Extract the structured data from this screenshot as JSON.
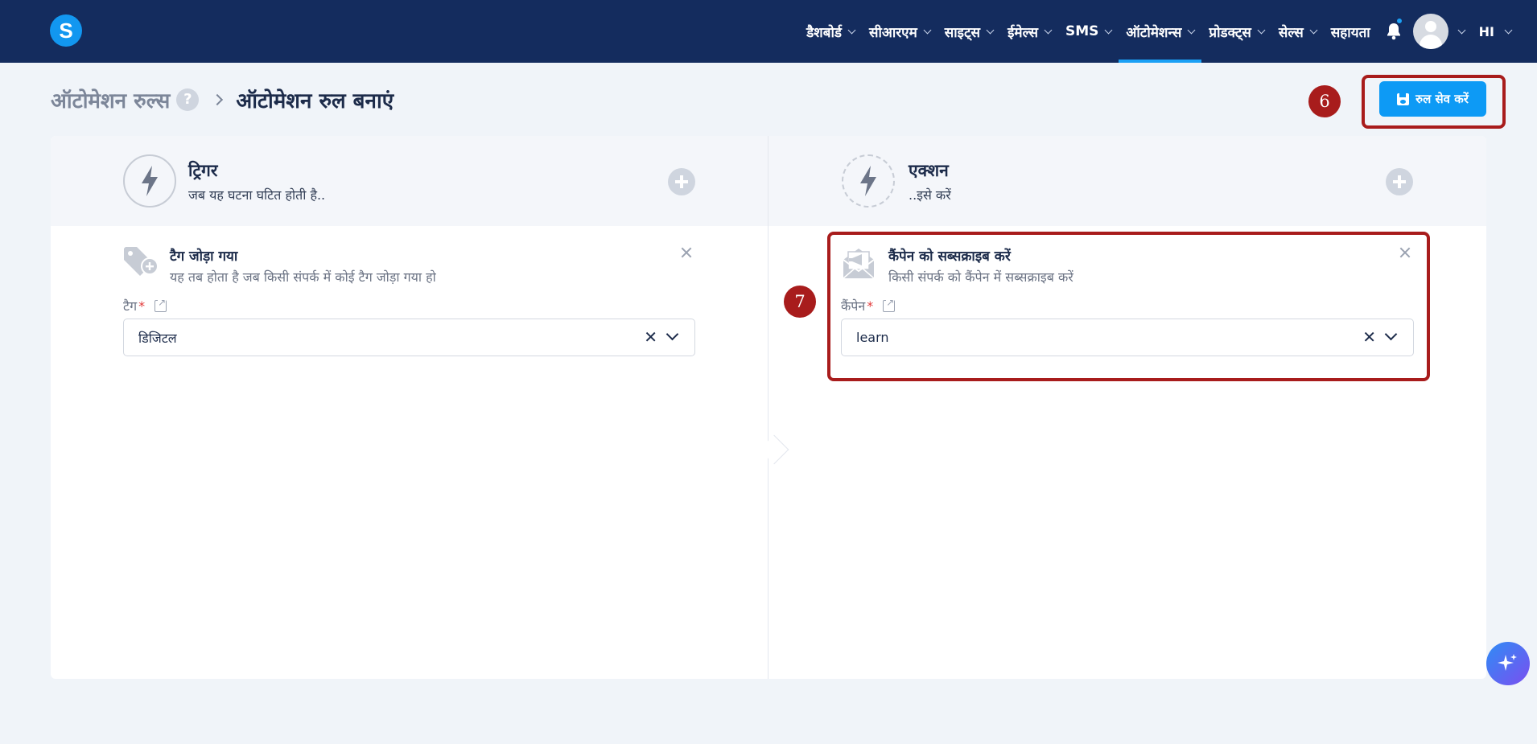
{
  "app": {
    "logo_letter": "S"
  },
  "nav": {
    "items": [
      {
        "label": "डैशबोर्ड",
        "has_menu": true
      },
      {
        "label": "सीआरएम",
        "has_menu": true
      },
      {
        "label": "साइट्स",
        "has_menu": true
      },
      {
        "label": "ईमेल्स",
        "has_menu": true
      },
      {
        "label": "SMS",
        "has_menu": true
      },
      {
        "label": "ऑटोमेशन्स",
        "has_menu": true,
        "active": true
      },
      {
        "label": "प्रोडक्ट्स",
        "has_menu": true
      },
      {
        "label": "सेल्स",
        "has_menu": true
      },
      {
        "label": "सहायता",
        "has_menu": false
      }
    ],
    "bell_icon": "bell-icon",
    "language": "HI"
  },
  "header": {
    "breadcrumb_parent": "ऑटोमेशन रुल्स",
    "help_label": "?",
    "breadcrumb_current": "ऑटोमेशन रुल बनाएं",
    "save_label": "रुल सेव करें"
  },
  "annotations": {
    "marker_save": "6",
    "marker_action": "7"
  },
  "trigger": {
    "title": "ट्रिगर",
    "subtitle": "जब यह घटना घटित होती है..",
    "item_title": "टैग जोड़ा गया",
    "item_desc": "यह तब होता है जब किसी संपर्क में कोई टैग जोड़ा गया हो",
    "field_label": "टैग",
    "field_value": "डिजिटल"
  },
  "action": {
    "title": "एक्शन",
    "subtitle": "..इसे करें",
    "item_title": "कैंपेन को सब्सक्राइब करें",
    "item_desc": "किसी संपर्क को कैंपेन में सब्सक्राइब करें",
    "field_label": "कैंपेन",
    "field_value": "learn"
  },
  "required_mark": "*",
  "clear_glyph": "✕",
  "colors": {
    "nav_bg": "#142c5e",
    "accent": "#0d9af5",
    "highlight": "#a81c1c"
  }
}
